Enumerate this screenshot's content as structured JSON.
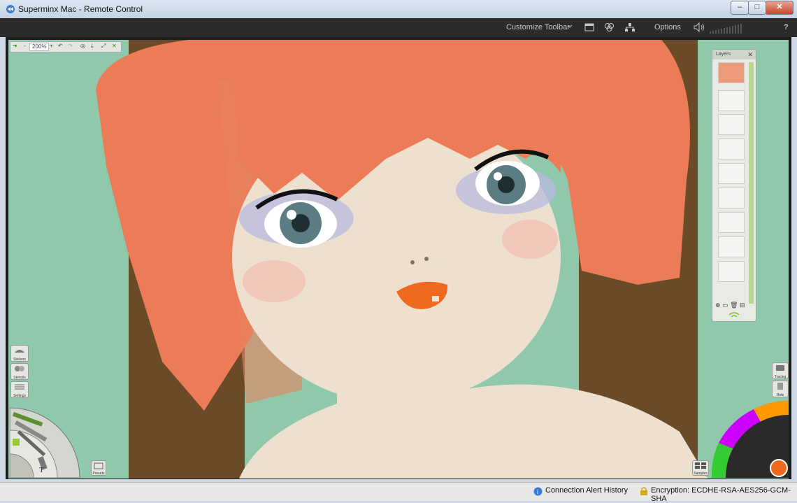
{
  "window": {
    "title": "Superminx Mac - Remote Control",
    "buttons": [
      "minimize",
      "maximize",
      "close"
    ]
  },
  "toolbar": {
    "customize_label": "Customize Toolbar",
    "options_label": "Options",
    "help_label": "?"
  },
  "canvas_toolbar": {
    "zoom": "200%",
    "minus": "-",
    "plus": "+"
  },
  "left_tools": [
    {
      "label": "Stickers",
      "icon": "stickers-icon"
    },
    {
      "label": "Stencils",
      "icon": "stencils-icon"
    },
    {
      "label": "Settings",
      "icon": "settings-icon"
    }
  ],
  "tool_wheel_letter": "T",
  "presets_label": "Presets",
  "layers": {
    "title": "Layers",
    "count": 9
  },
  "right_tools": [
    {
      "label": "Tracing",
      "icon": "tracing-icon"
    },
    {
      "label": "Refs",
      "icon": "references-icon"
    },
    {
      "label": "Samples",
      "icon": "samples-icon"
    }
  ],
  "status": {
    "alert_history": "Connection Alert History",
    "encryption": "Encryption: ECDHE-RSA-AES256-GCM-SHA"
  },
  "colors": {
    "hair": "#ec7c58",
    "background_green": "#8fc8ab",
    "background_brown": "#6b4a27",
    "skin": "#ede0cf"
  }
}
